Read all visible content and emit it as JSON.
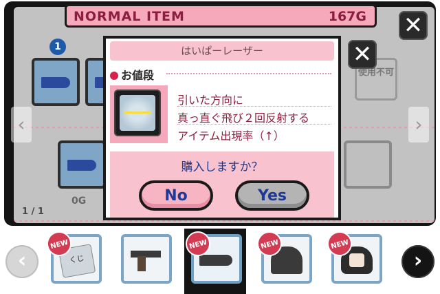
{
  "shop": {
    "header_title": "NORMAL ITEM",
    "money": "167G",
    "page_indicator": "1 / 1",
    "slot_number": "1",
    "bg_price_label": "0G",
    "unusable_label": "使用不可"
  },
  "dialog": {
    "item_name": "はいぱーレーザー",
    "price_label": "お値段",
    "description": [
      "引いた方向に",
      "真っ直ぐ飛び２回反射する",
      "アイテム出現率（↑）"
    ],
    "confirm_text": "購入しますか？",
    "no_label": "No",
    "yes_label": "Yes"
  },
  "close_glyph": "✕",
  "nav": {
    "left_glyph": "‹",
    "right_glyph": "›"
  },
  "bottom_tiles": [
    {
      "name": "くじ",
      "new": true,
      "badge": "NEW"
    },
    {
      "name": "gun",
      "new": false,
      "badge": ""
    },
    {
      "name": "bullet",
      "new": true,
      "badge": "NEW",
      "selected": true
    },
    {
      "name": "dress",
      "new": true,
      "badge": "NEW"
    },
    {
      "name": "hair",
      "new": true,
      "badge": "NEW"
    }
  ],
  "colors": {
    "accent_pink": "#f6a9bb",
    "title_text": "#8c1d3e",
    "confirm_text": "#213c8f",
    "new_badge": "#d23b52"
  }
}
